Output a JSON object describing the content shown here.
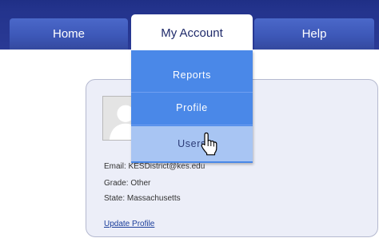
{
  "nav": {
    "tabs": [
      {
        "label": "Home"
      },
      {
        "label": "My Account"
      },
      {
        "label": "Help"
      }
    ]
  },
  "dropdown": {
    "items": [
      {
        "label": "Reports"
      },
      {
        "label": "Profile"
      },
      {
        "label": "Users",
        "hovered": true
      }
    ]
  },
  "profile": {
    "email": "Email: KESDistrict@kes.edu",
    "grade": "Grade: Other",
    "state": "State: Massachusetts",
    "update_link": "Update Profile"
  },
  "icons": {
    "avatar": "user-silhouette-icon",
    "cursor": "hand-pointer-icon"
  },
  "colors": {
    "nav_band": "#23338c",
    "tab": "#3d58b8",
    "dropdown": "#4a88e8",
    "dropdown_hover": "#a8c5f3",
    "card_bg": "#eceef8",
    "link": "#1a3d9a"
  }
}
